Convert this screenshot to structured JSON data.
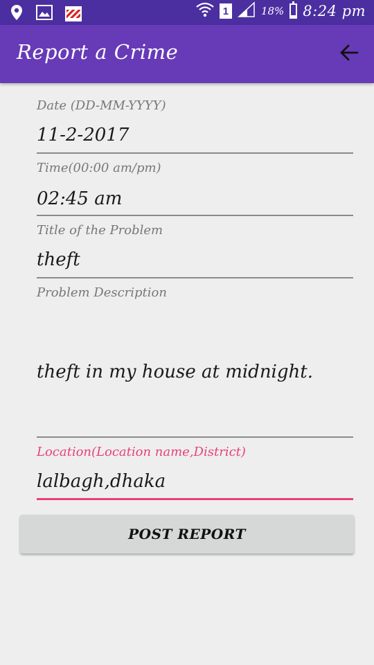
{
  "status_bar": {
    "battery_percent": "18%",
    "time": "8:24 pm",
    "sim_slot": "1",
    "icons": [
      "location-pin-icon",
      "gallery-icon",
      "notification-thumbnail-icon",
      "wifi-icon",
      "signal-icon",
      "battery-icon"
    ]
  },
  "app_bar": {
    "title": "Report a Crime",
    "back_icon": "arrow-back-icon",
    "color": "#673ab7"
  },
  "form": {
    "date": {
      "label": "Date (DD-MM-YYYY)",
      "value": "11-2-2017"
    },
    "time": {
      "label": "Time(00:00 am/pm)",
      "value": "02:45 am"
    },
    "title": {
      "label": "Title of the Problem",
      "value": "theft"
    },
    "description": {
      "label": "Problem Description",
      "value": "theft in my house at midnight."
    },
    "location": {
      "label": "Location(Location name,District)",
      "value": "lalbagh,dhaka",
      "focused": true,
      "accent_color": "#e8407a"
    }
  },
  "post_button": {
    "label": "POST REPORT"
  }
}
